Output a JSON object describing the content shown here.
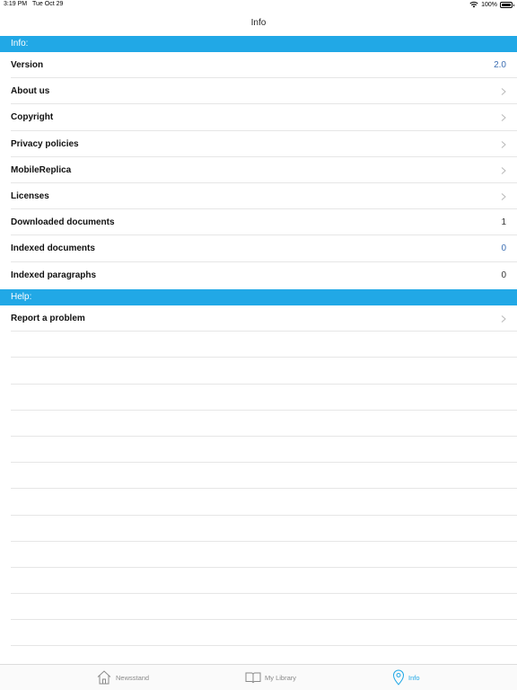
{
  "status_bar": {
    "time": "3:19 PM",
    "date": "Tue Oct 29",
    "battery": "100%"
  },
  "nav": {
    "title": "Info"
  },
  "sections": {
    "info_header": "Info:",
    "help_header": "Help:"
  },
  "info_rows": [
    {
      "label": "Version",
      "value": "2.0"
    },
    {
      "label": "About us"
    },
    {
      "label": "Copyright"
    },
    {
      "label": "Privacy policies"
    },
    {
      "label": "MobileReplica"
    },
    {
      "label": "Licenses"
    },
    {
      "label": "Downloaded documents",
      "value": "1"
    },
    {
      "label": "Indexed documents",
      "value": "0"
    },
    {
      "label": "Indexed paragraphs",
      "value": "0"
    }
  ],
  "help_rows": [
    {
      "label": "Report a problem"
    }
  ],
  "tabs": [
    {
      "label": "Newsstand",
      "icon": "house-icon"
    },
    {
      "label": "My Library",
      "icon": "book-icon"
    },
    {
      "label": "Info",
      "icon": "location-pin-icon"
    }
  ],
  "colors": {
    "accent": "#21a8e6",
    "value_link": "#3d6fb3"
  }
}
